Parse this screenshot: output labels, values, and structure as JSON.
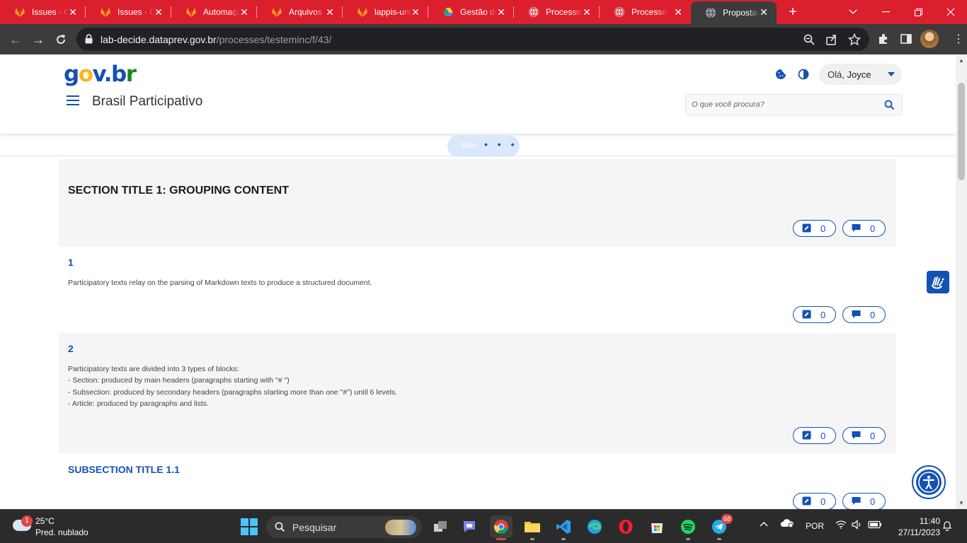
{
  "browser": {
    "tabs": [
      {
        "title": "Issues · GitLab",
        "icon": "gitlab-icon"
      },
      {
        "title": "Issues · GitLab",
        "icon": "gitlab-icon"
      },
      {
        "title": "Automação",
        "icon": "gitlab-icon"
      },
      {
        "title": "Arquivos",
        "icon": "gitlab-icon"
      },
      {
        "title": "lappis-unb",
        "icon": "gitlab-icon"
      },
      {
        "title": "Gestão de",
        "icon": "google-drive-icon"
      },
      {
        "title": "Processo",
        "icon": "globe-icon"
      },
      {
        "title": "Processo",
        "icon": "globe-icon"
      },
      {
        "title": "Propostas",
        "icon": "globe-icon",
        "active": true
      }
    ],
    "url_host": "lab-decide.dataprev.gov.br",
    "url_path": "/processes/testeminc/f/43/"
  },
  "header": {
    "logo": {
      "g": "g",
      "o": "o",
      "v": "v",
      "dot": ".",
      "b": "b",
      "r": "r"
    },
    "site_title": "Brasil Participativo",
    "greeting": "Olá,",
    "user_name": "Joyce",
    "search_placeholder": "O que você procura?"
  },
  "more": {
    "label": "Mais",
    "dots": "• • •"
  },
  "sections": {
    "section_title": "SECTION TITLE 1: GROUPING CONTENT",
    "article1_num": "1",
    "article1_text": "Participatory texts relay on the parsing of Markdown texts to produce a structured document.",
    "article2_num": "2",
    "article2_text": "Participatory texts are divided into 3 types of blocks:\n- Section: produced by main headers (paragraphs starting with \"# \")\n- Subsection: produced by secondary headers (paragraphs starting more than one \"#\") until 6 levels.\n- Article: produced by paragraphs and lists.",
    "subsection_title": "SUBSECTION TITLE 1.1"
  },
  "counters": {
    "amend_0": "0",
    "comment_0": "0",
    "amend_1": "0",
    "comment_1": "0",
    "amend_2": "0",
    "comment_2": "0",
    "amend_3": "0",
    "comment_3": "0"
  },
  "taskbar": {
    "weather_badge": "1",
    "temperature": "25°C",
    "weather_desc": "Pred. nublado",
    "search_label": "Pesquisar",
    "telegram_badge": "68",
    "language": "POR",
    "time": "11:40",
    "date": "27/11/2023"
  },
  "colors": {
    "tabstrip": "#dc1f2e",
    "govbr_blue": "#1351b4",
    "govbr_yellow": "#f8b81f",
    "govbr_green": "#168821"
  }
}
